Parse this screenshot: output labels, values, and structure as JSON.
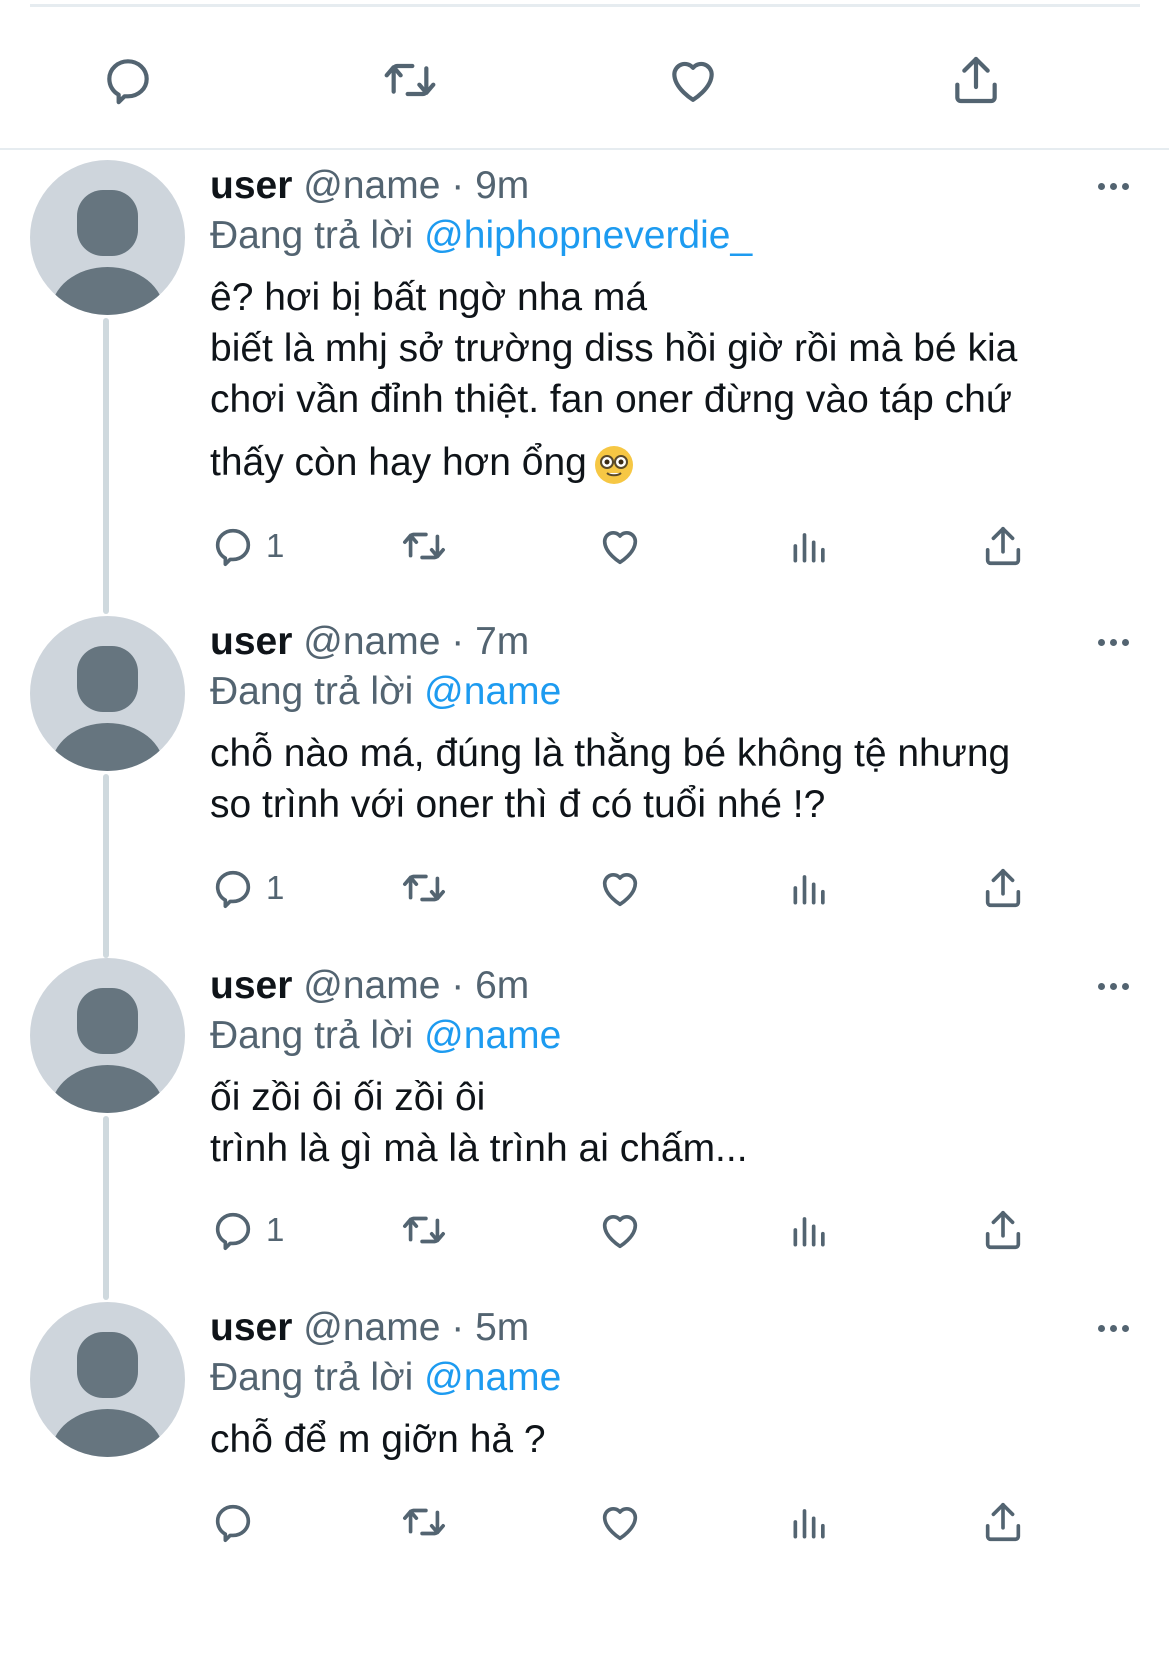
{
  "top_actions": [
    {
      "name": "reply-icon"
    },
    {
      "name": "retweet-icon"
    },
    {
      "name": "like-icon"
    },
    {
      "name": "share-icon"
    }
  ],
  "tweets": [
    {
      "user": "user",
      "handle": "@name",
      "dot": "·",
      "time": "9m",
      "reply_prefix": "Đang trả lời",
      "reply_to": "@hiphopneverdie_",
      "lines": [
        "ê? hơi bị bất ngờ nha má",
        "biết là mhj sở trường diss hồi giờ rồi mà bé kia",
        "chơi vần đỉnh thiệt. fan oner đừng vào táp chứ",
        "thấy còn hay hơn ổng"
      ],
      "emoji": "nerd-face",
      "reply_count": "1"
    },
    {
      "user": "user",
      "handle": "@name",
      "dot": "·",
      "time": "7m",
      "reply_prefix": "Đang trả lời",
      "reply_to": "@name",
      "lines": [
        "chỗ nào má, đúng là thằng bé không tệ nhưng",
        "so trình với oner thì đ có tuổi nhé !?"
      ],
      "reply_count": "1"
    },
    {
      "user": "user",
      "handle": "@name",
      "dot": "·",
      "time": "6m",
      "reply_prefix": "Đang trả lời",
      "reply_to": "@name",
      "lines": [
        "ối zồi ôi ối zồi ôi",
        "trình là gì mà là trình ai chấm..."
      ],
      "reply_count": "1"
    },
    {
      "user": "user",
      "handle": "@name",
      "dot": "·",
      "time": "5m",
      "reply_prefix": "Đang trả lời",
      "reply_to": "@name",
      "lines": [
        "chỗ để m giỡn hả ?"
      ],
      "reply_count": ""
    }
  ],
  "colors": {
    "text": "#0f1419",
    "secondary": "#536471",
    "link": "#1d9bf0",
    "divider": "#e6ecf0",
    "avatar_bg": "#ced5dc",
    "avatar_fg": "#66757f"
  }
}
